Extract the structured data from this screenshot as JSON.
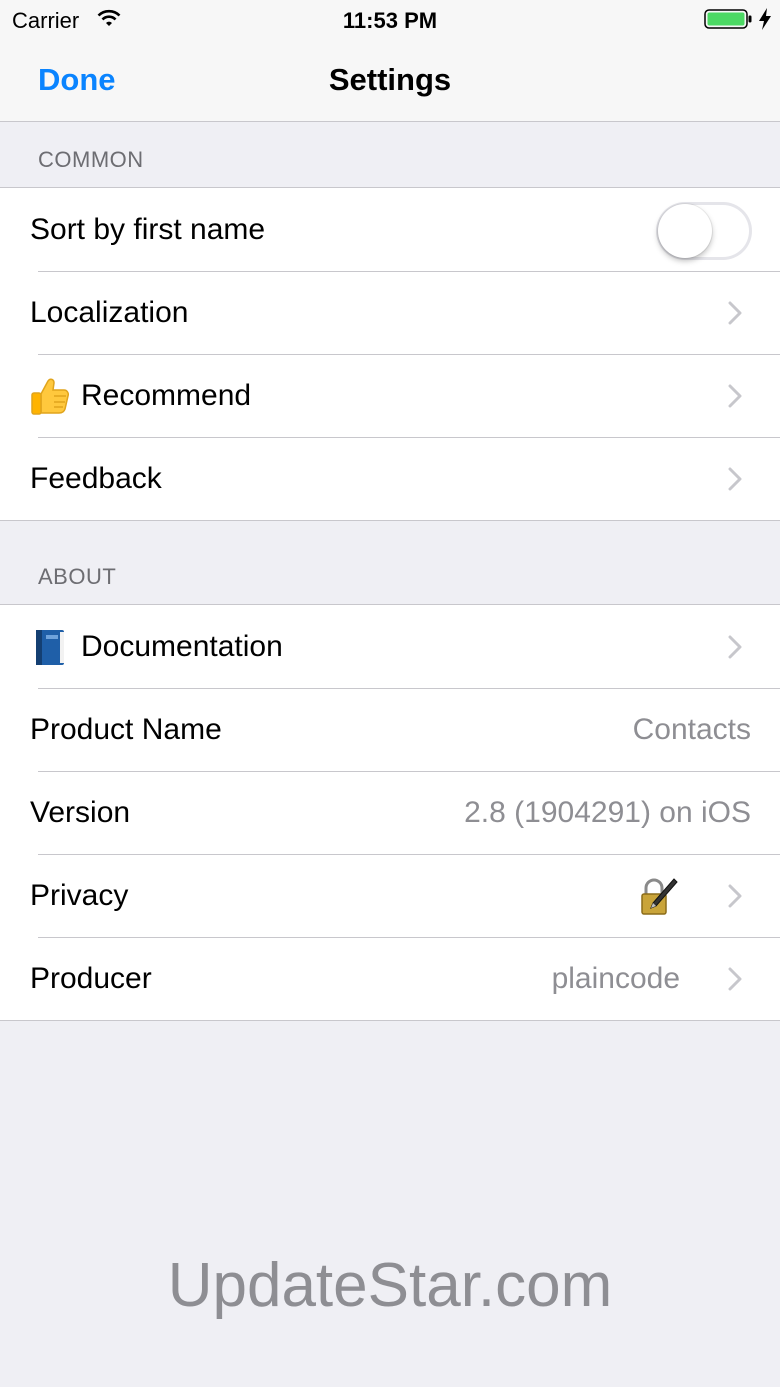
{
  "status_bar": {
    "carrier": "Carrier",
    "time": "11:53 PM",
    "battery_color": "#4cd964"
  },
  "nav": {
    "done_label": "Done",
    "title": "Settings",
    "accent": "#0a84ff"
  },
  "common": {
    "header": "COMMON",
    "sort_label": "Sort by first name",
    "sort_enabled": false,
    "localization_label": "Localization",
    "recommend_label": "Recommend",
    "recommend_icon": "thumbs-up-icon",
    "feedback_label": "Feedback"
  },
  "about": {
    "header": "ABOUT",
    "documentation_label": "Documentation",
    "documentation_icon": "book-icon",
    "product_name_label": "Product Name",
    "product_name_value": "Contacts",
    "version_label": "Version",
    "version_value": "2.8 (1904291) on iOS",
    "privacy_label": "Privacy",
    "privacy_icon": "lock-pen-icon",
    "producer_label": "Producer",
    "producer_value": "plaincode"
  },
  "watermark": "UpdateStar.com"
}
